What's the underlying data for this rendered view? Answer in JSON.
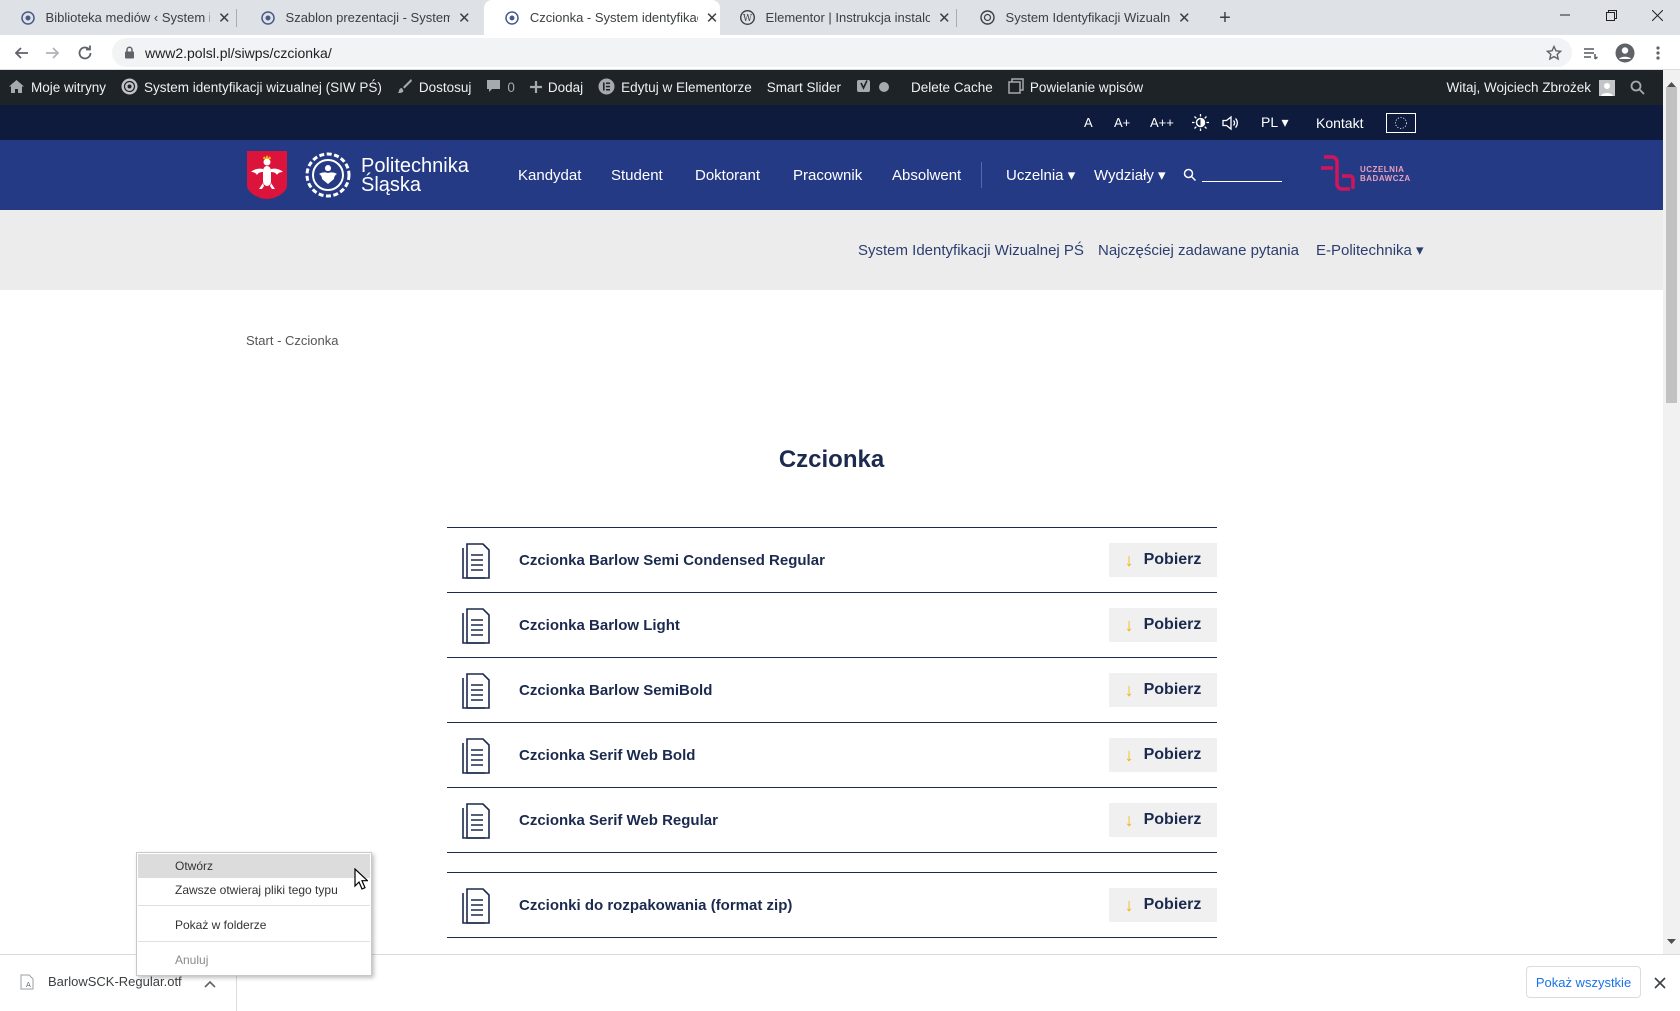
{
  "browser": {
    "tabs": [
      {
        "title": "Biblioteka mediów ‹ System ident",
        "active": false
      },
      {
        "title": "Szablon prezentacji - System ider",
        "active": false
      },
      {
        "title": "Czcionka - System identyfikacji w",
        "active": true
      },
      {
        "title": "Elementor | Instrukcja instalowan",
        "active": false
      },
      {
        "title": "System Identyfikacji Wizualnej Po",
        "active": false
      }
    ],
    "new_tab": "+",
    "url": "www2.polsl.pl/siwps/czcionka/"
  },
  "adminbar": {
    "items": [
      "Moje witryny",
      "System identyfikacji wizualnej (SIW PŚ)",
      "Dostosuj",
      "0",
      "Dodaj",
      "Edytuj w Elementorze",
      "Smart Slider",
      "Delete Cache",
      "Powielanie wpisów"
    ],
    "greeting": "Witaj, Wojciech Zbrożek"
  },
  "utilbar": {
    "font_a": "A",
    "font_a_plus": "A+",
    "font_a_plus_plus": "A++",
    "lang": "PL ▾",
    "contact": "Kontakt"
  },
  "header": {
    "logo_line1": "Politechnika",
    "logo_line2": "Śląska",
    "nav": [
      "Kandydat",
      "Student",
      "Doktorant",
      "Pracownik",
      "Absolwent",
      "Uczelnia ▾",
      "Wydziały ▾"
    ],
    "badge_line1": "UCZELNIA",
    "badge_line2": "BADAWCZA"
  },
  "subnav": [
    "System Identyfikacji Wizualnej PŚ",
    "Najczęściej zadawane pytania",
    "E-Politechnika ▾"
  ],
  "breadcrumb": "Start - Czcionka",
  "page_title": "Czcionka",
  "files": [
    {
      "name": "Czcionka Barlow Semi Condensed Regular",
      "button": "Pobierz"
    },
    {
      "name": "Czcionka Barlow Light",
      "button": "Pobierz"
    },
    {
      "name": "Czcionka Barlow SemiBold",
      "button": "Pobierz"
    },
    {
      "name": "Czcionka Serif Web Bold",
      "button": "Pobierz"
    },
    {
      "name": "Czcionka Serif Web Regular",
      "button": "Pobierz"
    },
    {
      "name": "Czcionki do rozpakowania (format zip)",
      "button": "Pobierz"
    }
  ],
  "context_menu": {
    "items": [
      "Otwórz",
      "Zawsze otwieraj pliki tego typu",
      "Pokaż w folderze",
      "Anuluj"
    ]
  },
  "downloads": {
    "filename": "BarlowSCK-Regular.otf",
    "show_all": "Pokaż wszystkie"
  },
  "colors": {
    "admin_bar": "#1d2327",
    "util_bar": "#0e1b3d",
    "nav": "#253a84",
    "accent_arrow": "#f0b400",
    "badge": "#d4145a"
  }
}
